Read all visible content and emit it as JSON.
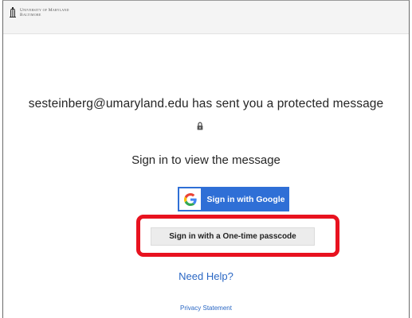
{
  "header": {
    "logo_icon": "university-tower-icon",
    "logo_line1": "University of Maryland",
    "logo_line2": "Baltimore"
  },
  "main": {
    "message": "sesteinberg@umaryland.edu has sent you a protected message",
    "lock_icon": "lock-icon",
    "prompt": "Sign in to view the message",
    "google_button_label": "Sign in with Google",
    "google_icon": "google-g-icon",
    "otp_button_label": "Sign in with a One-time passcode",
    "need_help": "Need Help?",
    "privacy": "Privacy Statement"
  },
  "colors": {
    "google_button": "#2f6fd6",
    "link": "#2a67c4",
    "highlight": "#e8121f",
    "otp_button": "#ececec"
  }
}
